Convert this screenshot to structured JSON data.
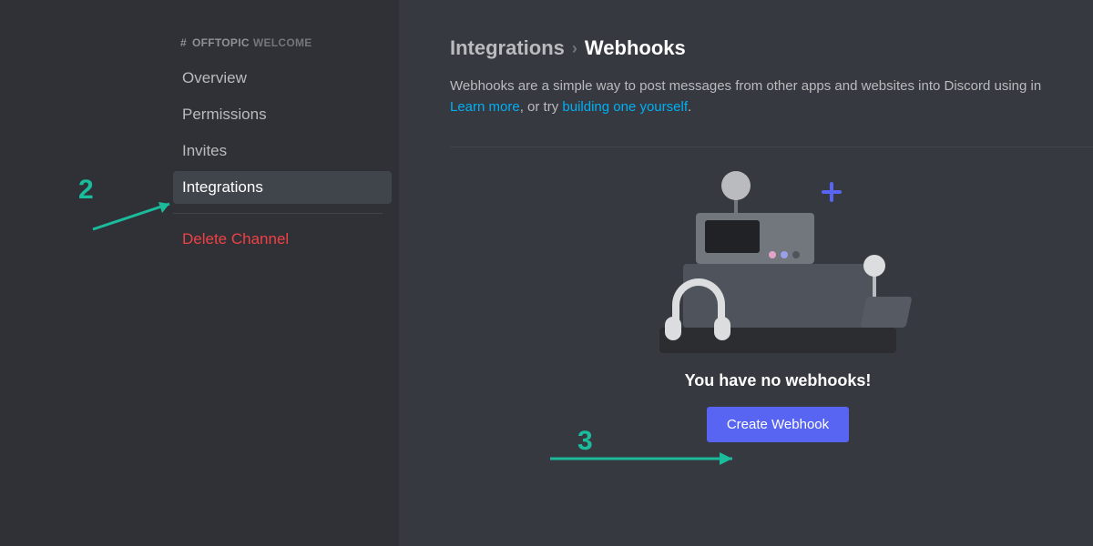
{
  "sidebar": {
    "channel_name": "OFFTOPIC",
    "channel_sub": "WELCOME",
    "items": [
      {
        "label": "Overview"
      },
      {
        "label": "Permissions"
      },
      {
        "label": "Invites"
      },
      {
        "label": "Integrations"
      }
    ],
    "delete_label": "Delete Channel"
  },
  "main": {
    "breadcrumb_parent": "Integrations",
    "breadcrumb_current": "Webhooks",
    "desc_prefix": "Webhooks are a simple way to post messages from other apps and websites into Discord using in",
    "link_learn": "Learn more",
    "desc_mid": ", or try ",
    "link_build": "building one yourself",
    "desc_suffix": ".",
    "empty_title": "You have no webhooks!",
    "button_label": "Create Webhook"
  },
  "annotations": {
    "step2": "2",
    "step3": "3"
  }
}
